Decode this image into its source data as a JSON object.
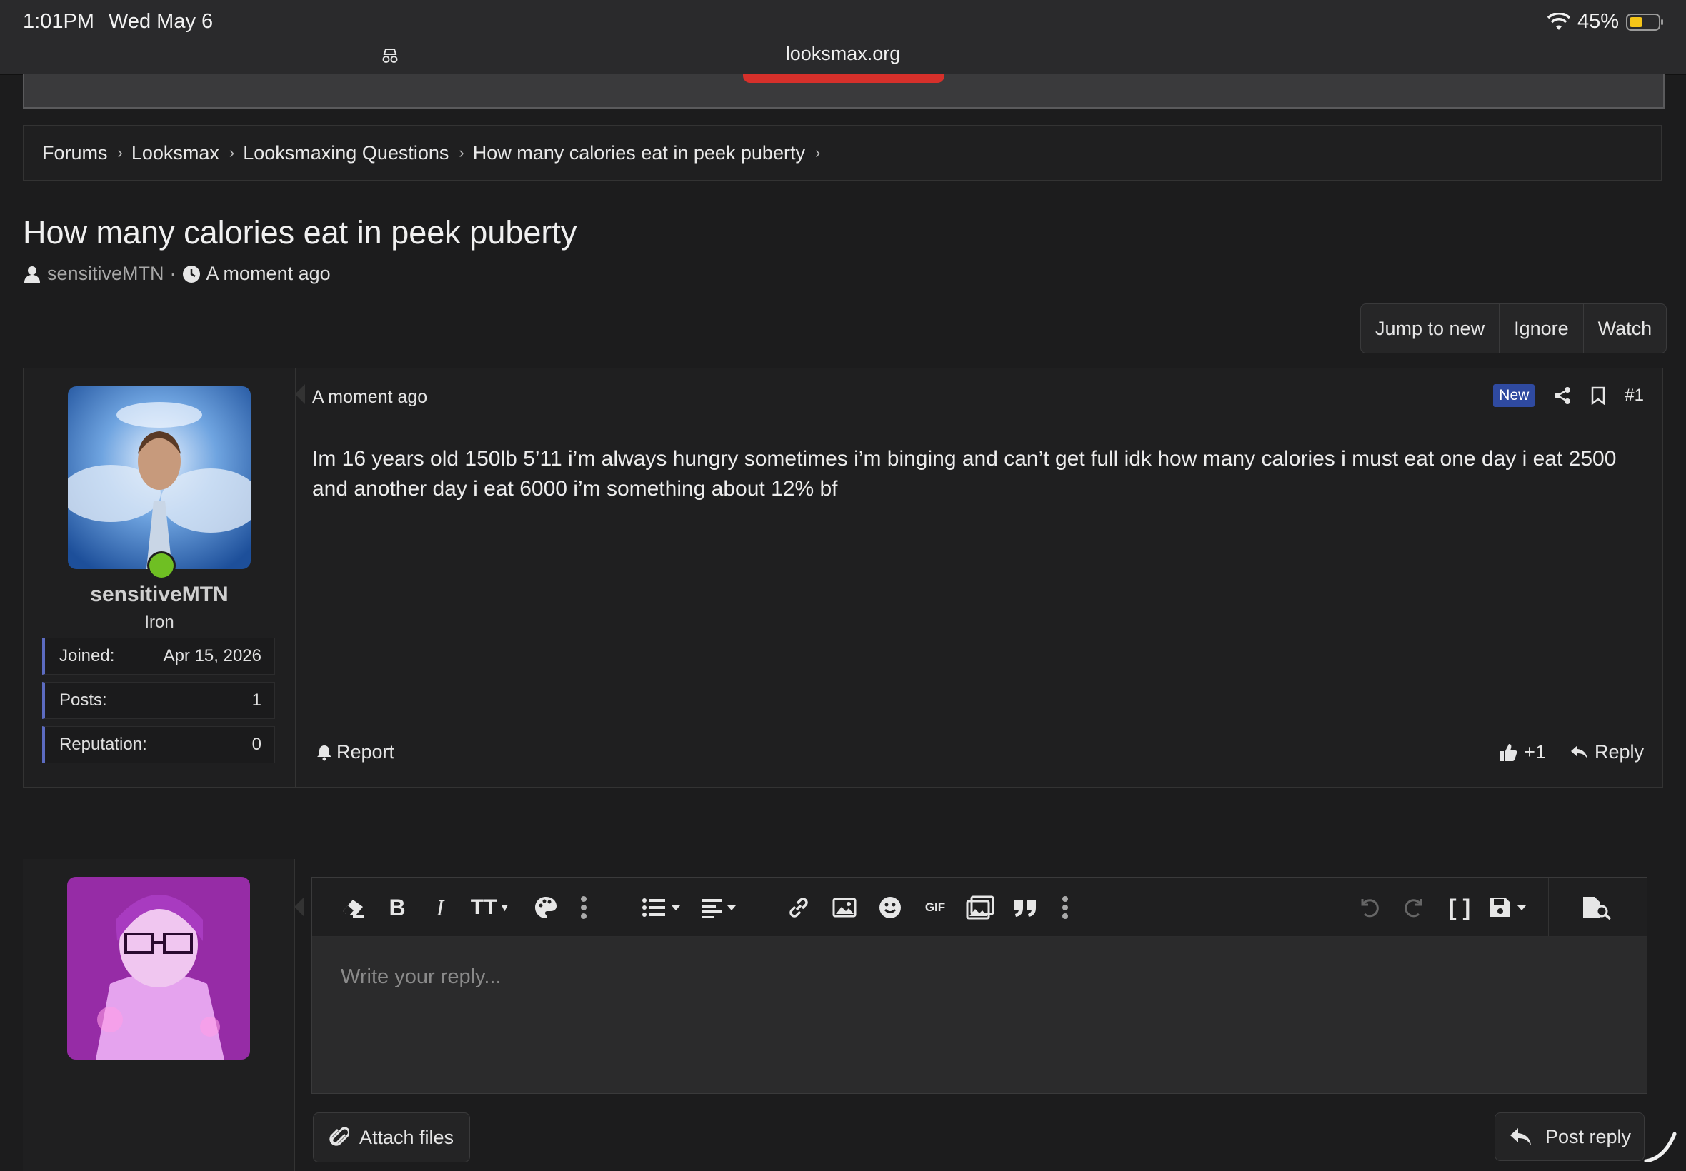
{
  "status": {
    "time": "1:01PM",
    "date": "Wed May 6",
    "battery": "45%"
  },
  "browser": {
    "url": "looksmax.org"
  },
  "breadcrumb": [
    "Forums",
    "Looksmax",
    "Looksmaxing Questions",
    "How many calories eat in peek puberty"
  ],
  "thread": {
    "title": "How many calories eat in peek puberty",
    "author": "sensitiveMTN",
    "time": "A moment ago",
    "buttons": {
      "jump": "Jump to new",
      "ignore": "Ignore",
      "watch": "Watch"
    }
  },
  "post": {
    "username": "sensitiveMTN",
    "user_title": "Iron",
    "stats": [
      {
        "label": "Joined:",
        "value": "Apr 15, 2026"
      },
      {
        "label": "Posts:",
        "value": "1"
      },
      {
        "label": "Reputation:",
        "value": "0"
      }
    ],
    "date": "A moment ago",
    "badge": "New",
    "number": "#1",
    "body": "Im 16 years old 150lb 5’11 i’m always hungry sometimes i’m binging and can’t get full idk how many calories i must eat one day i eat 2500 and another day i eat 6000 i’m something about 12% bf",
    "report": "Report",
    "reaction": "+1",
    "reply": "Reply"
  },
  "editor": {
    "placeholder": "Write your reply...",
    "attach_label": "Attach files",
    "post_reply_label": "Post reply"
  },
  "colors": {
    "accent": "#5c6bc0",
    "online": "#6fbf23",
    "badge": "#2f4aa0",
    "banner_red": "#d6302b"
  }
}
